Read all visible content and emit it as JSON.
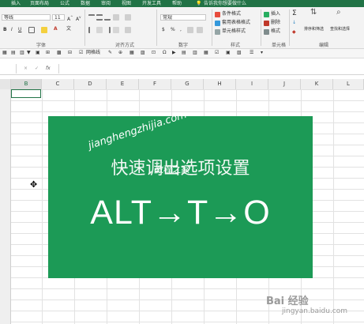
{
  "ribbon": {
    "tabs": [
      "插入",
      "页面布局",
      "公式",
      "数据",
      "审阅",
      "视图",
      "开发工具",
      "帮助"
    ],
    "tell_me": "告诉我你想要做什么",
    "font_name": "等线",
    "font_size": "11",
    "number_format": "常规",
    "bold": "B",
    "italic": "I",
    "underline": "U",
    "cond_format": "条件格式",
    "table_format": "套用表格格式",
    "cell_style": "单元格样式",
    "insert": "插入",
    "delete": "删除",
    "format": "格式",
    "sum_glyph": "Σ",
    "sort_filter": "排序和筛选",
    "find_select": "查找和选择",
    "group_font": "字体",
    "group_align": "对齐方式",
    "group_number": "数字",
    "group_style": "样式",
    "group_cells": "单元格",
    "group_edit": "编辑"
  },
  "quick_toolbar": {
    "gridlines": "网格线"
  },
  "formula_bar": {
    "cancel": "×",
    "enter": "✓",
    "fx": "fx",
    "value": ""
  },
  "columns": [
    "B",
    "C",
    "D",
    "E",
    "F",
    "G",
    "H",
    "I",
    "J",
    "K",
    "L"
  ],
  "card": {
    "subtitle": "快速调出选项设置",
    "shortcut": "ALT→T→O",
    "color": "#1c9a56"
  },
  "watermark": {
    "url": "jianghengzhijia.com",
    "name": "教程之家"
  },
  "baidu": {
    "logo": "Bai 经验",
    "domain": "jingyan.baidu.com"
  },
  "cursor": "✥"
}
